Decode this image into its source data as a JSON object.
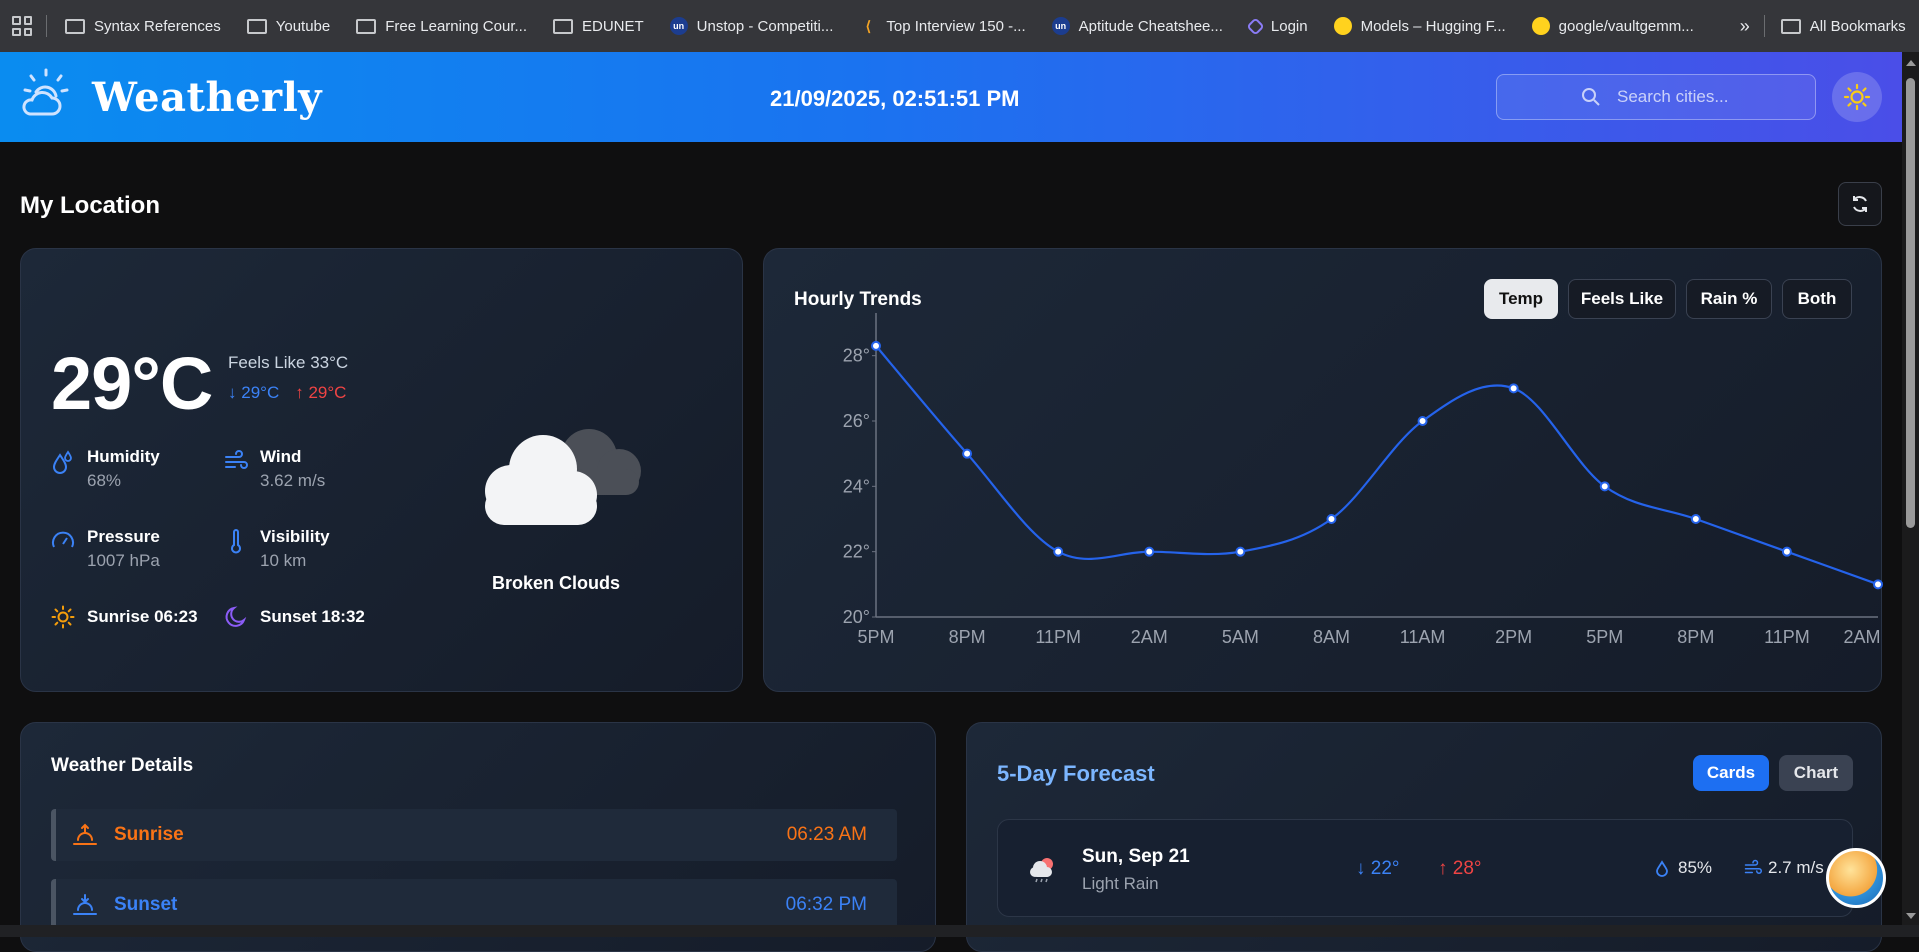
{
  "bookmarks": {
    "items": [
      {
        "label": "Syntax References",
        "icon": "folder-icon"
      },
      {
        "label": "Youtube",
        "icon": "folder-icon"
      },
      {
        "label": "Free Learning Cour...",
        "icon": "folder-icon"
      },
      {
        "label": "EDUNET",
        "icon": "folder-icon"
      },
      {
        "label": "Unstop - Competiti...",
        "icon": "unstop-icon"
      },
      {
        "label": "Top Interview 150 -...",
        "icon": "leetcode-icon"
      },
      {
        "label": "Aptitude Cheatshee...",
        "icon": "unstop-icon"
      },
      {
        "label": "Login",
        "icon": "login-icon"
      },
      {
        "label": "Models – Hugging F...",
        "icon": "huggingface-icon"
      },
      {
        "label": "google/vaultgemm...",
        "icon": "huggingface-icon"
      }
    ],
    "overflow": "»",
    "all_bookmarks": "All Bookmarks"
  },
  "header": {
    "brand": "Weatherly",
    "datetime": "21/09/2025, 02:51:51 PM",
    "search_placeholder": "Search cities..."
  },
  "location": {
    "title": "My Location"
  },
  "current": {
    "temp": "29°C",
    "feels_like": "Feels Like 33°C",
    "min": "29°C",
    "max": "29°C",
    "humidity_label": "Humidity",
    "humidity": "68%",
    "wind_label": "Wind",
    "wind": "3.62 m/s",
    "pressure_label": "Pressure",
    "pressure": "1007 hPa",
    "visibility_label": "Visibility",
    "visibility": "10 km",
    "sunrise": "Sunrise 06:23",
    "sunset": "Sunset 18:32",
    "condition": "Broken Clouds"
  },
  "hourly": {
    "title": "Hourly Trends",
    "tabs": [
      "Temp",
      "Feels Like",
      "Rain %",
      "Both"
    ],
    "active_tab": "Temp"
  },
  "chart_data": {
    "type": "line",
    "categories": [
      "5PM",
      "8PM",
      "11PM",
      "2AM",
      "5AM",
      "8AM",
      "11AM",
      "2PM",
      "5PM",
      "8PM",
      "11PM",
      "2AM"
    ],
    "values": [
      28.3,
      25,
      22,
      22,
      22,
      23,
      26,
      27,
      24,
      23,
      22,
      21
    ],
    "ylim": [
      20,
      29
    ],
    "yticks": [
      "20°",
      "22°",
      "24°",
      "26°",
      "28°"
    ],
    "grid": false,
    "color": "#2563eb"
  },
  "details": {
    "title": "Weather Details",
    "rows": [
      {
        "label": "Sunrise",
        "value": "06:23 AM",
        "color": "#f97316"
      },
      {
        "label": "Sunset",
        "value": "06:32 PM",
        "color": "#3b82f6"
      }
    ]
  },
  "forecast": {
    "title": "5-Day Forecast",
    "view_cards": "Cards",
    "view_chart": "Chart",
    "days": [
      {
        "day": "Sun, Sep 21",
        "desc": "Light Rain",
        "lo": "22°",
        "hi": "28°",
        "rain": "85%",
        "wind": "2.7 m/s"
      }
    ]
  },
  "colors": {
    "accent": "#1a73f0",
    "cold": "#3b82f6",
    "hot": "#ef4444"
  }
}
